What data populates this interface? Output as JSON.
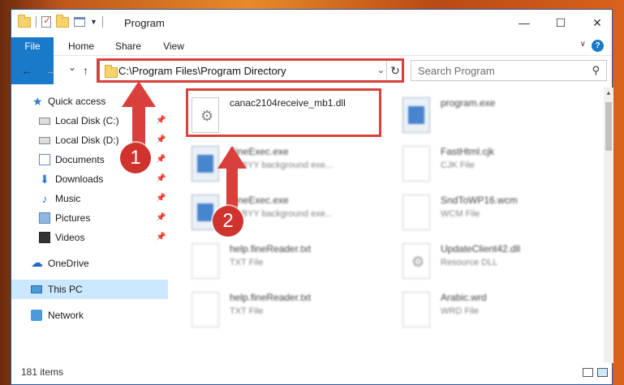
{
  "window": {
    "title": "Program"
  },
  "controls": {
    "minimize": "—",
    "maximize": "☐",
    "close": "✕"
  },
  "ribbon": {
    "tabs": [
      "File",
      "Home",
      "Share",
      "View"
    ],
    "help": "?"
  },
  "nav": {
    "back": "←",
    "forward": "→",
    "recent": "⌄",
    "up": "↑"
  },
  "address": {
    "path": "C:\\Program Files\\Program Directory",
    "refresh": "↻",
    "dropdown": "⌄"
  },
  "search": {
    "placeholder": "Search Program",
    "icon": "⚲"
  },
  "sidebar": {
    "items": [
      {
        "label": "Quick access",
        "icon": "star-icon"
      },
      {
        "label": "Local Disk (C:)",
        "icon": "drive-icon",
        "pinned": true
      },
      {
        "label": "Local Disk (D:)",
        "icon": "drive-icon",
        "pinned": true
      },
      {
        "label": "Documents",
        "icon": "documents-icon",
        "pinned": true
      },
      {
        "label": "Downloads",
        "icon": "download-icon",
        "pinned": true
      },
      {
        "label": "Music",
        "icon": "music-icon",
        "pinned": true
      },
      {
        "label": "Pictures",
        "icon": "pictures-icon",
        "pinned": true
      },
      {
        "label": "Videos",
        "icon": "videos-icon",
        "pinned": true
      },
      {
        "label": "OneDrive",
        "icon": "cloud-icon"
      },
      {
        "label": "This PC",
        "icon": "computer-icon"
      },
      {
        "label": "Network",
        "icon": "network-icon"
      }
    ]
  },
  "files": [
    {
      "name": "canac2104receive_mb1.dll",
      "type": ""
    },
    {
      "name": "program.exe",
      "type": ""
    },
    {
      "name": "FineExec.exe",
      "type": "ABBYY background exe..."
    },
    {
      "name": "FastHtml.cjk",
      "type": "CJK File"
    },
    {
      "name": "FineExec.exe",
      "type": "ABBYY background exe..."
    },
    {
      "name": "SndToWP16.wcm",
      "type": "WCM File"
    },
    {
      "name": "help.fineReader.txt",
      "type": "TXT File"
    },
    {
      "name": "UpdateClient42.dll",
      "type": "Resource DLL"
    },
    {
      "name": "help.fineReader.txt",
      "type": "TXT File"
    },
    {
      "name": "Arabic.wrd",
      "type": "WRD File"
    }
  ],
  "status": {
    "items": "181 items"
  },
  "annotations": {
    "one": "1",
    "two": "2"
  },
  "colors": {
    "accent": "#1979ca",
    "highlight": "#d9403b",
    "selected": "#cce8ff"
  }
}
